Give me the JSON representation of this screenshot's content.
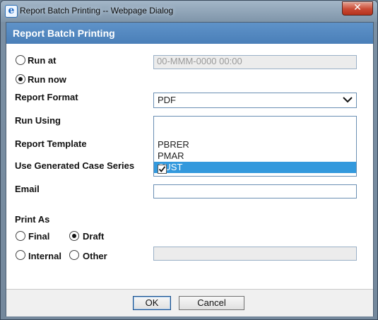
{
  "window": {
    "title": "Report Batch Printing -- Webpage Dialog",
    "app_icon": "ie-icon",
    "close_glyph": "✕"
  },
  "dialog": {
    "header": "Report Batch Printing",
    "run_at": {
      "label": "Run at",
      "selected": false,
      "placeholder": "00-MMM-0000 00:00"
    },
    "run_now": {
      "label": "Run now",
      "selected": true
    },
    "report_format": {
      "label": "Report Format",
      "value": "PDF"
    },
    "run_using": {
      "label": "Run Using"
    },
    "template_options": [
      {
        "label": "PBRER",
        "selected": false
      },
      {
        "label": "PMAR",
        "selected": false
      },
      {
        "label": "CUST",
        "selected": true
      }
    ],
    "report_template": {
      "label": "Report Template"
    },
    "use_generated_case_series": {
      "label": "Use Generated Case Series",
      "checked": true
    },
    "email": {
      "label": "Email",
      "value": ""
    },
    "print_as": {
      "label": "Print As",
      "options": [
        {
          "label": "Final",
          "selected": false
        },
        {
          "label": "Draft",
          "selected": true
        },
        {
          "label": "Internal",
          "selected": false
        },
        {
          "label": "Other",
          "selected": false
        }
      ],
      "other_value": ""
    }
  },
  "footer": {
    "ok_label": "OK",
    "cancel_label": "Cancel"
  },
  "colors": {
    "header_bg": "#4a7fb8",
    "selected_option_bg": "#3399dd",
    "close_button": "#c94a34"
  }
}
